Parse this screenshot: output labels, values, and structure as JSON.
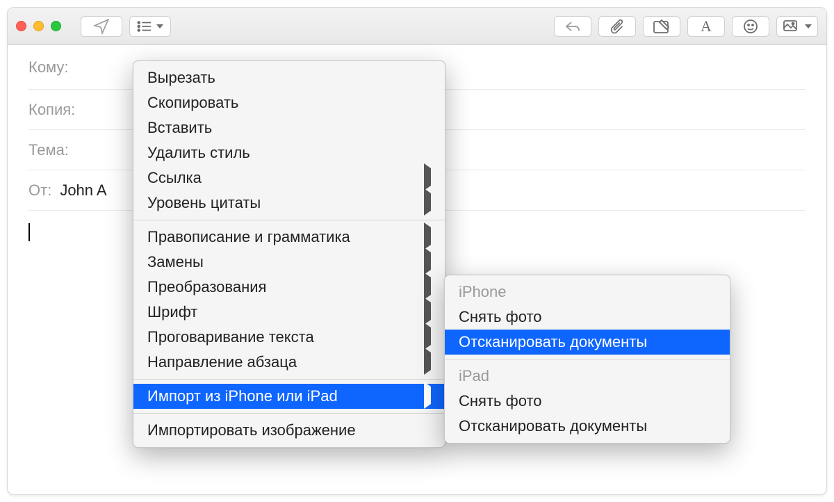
{
  "fields": {
    "to_label": "Кому:",
    "cc_label": "Копия:",
    "subject_label": "Тема:",
    "from_label": "От:",
    "from_value": "John A"
  },
  "context_menu": {
    "cut": "Вырезать",
    "copy": "Скопировать",
    "paste": "Вставить",
    "remove_style": "Удалить стиль",
    "link": "Ссылка",
    "quote_level": "Уровень цитаты",
    "spelling": "Правописание и грамматика",
    "substitutions": "Замены",
    "transformations": "Преобразования",
    "font": "Шрифт",
    "speech": "Проговаривание текста",
    "paragraph_direction": "Направление абзаца",
    "import_device": "Импорт из iPhone или iPad",
    "import_image": "Импортировать изображение"
  },
  "submenu": {
    "iphone_header": "iPhone",
    "iphone_photo": "Снять фото",
    "iphone_scan": "Отсканировать документы",
    "ipad_header": "iPad",
    "ipad_photo": "Снять фото",
    "ipad_scan": "Отсканировать документы"
  }
}
